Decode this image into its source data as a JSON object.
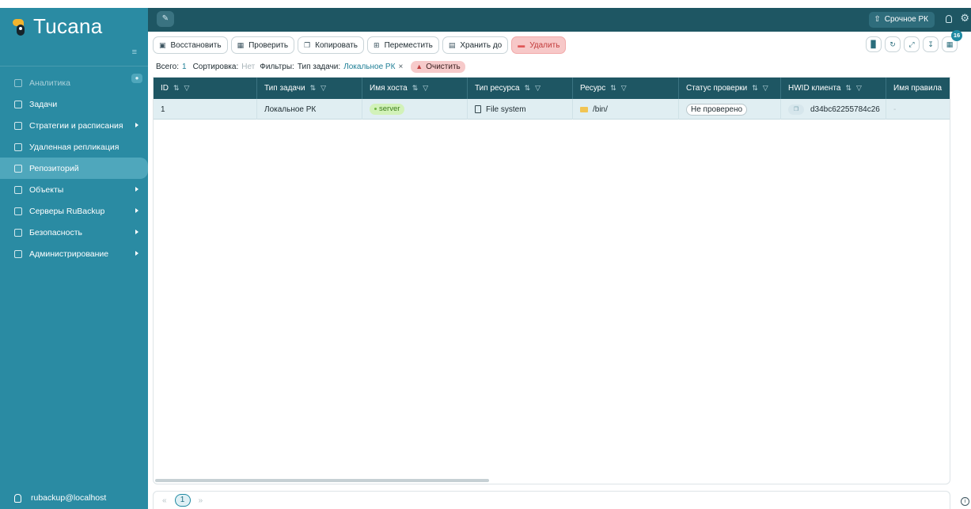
{
  "app": {
    "name": "Tucana"
  },
  "sidebar": {
    "items": [
      {
        "label": "Аналитика",
        "icon": "grid-icon",
        "dim": true
      },
      {
        "label": "Задачи",
        "icon": "tasks-icon"
      },
      {
        "label": "Стратегии и расписания",
        "icon": "calendar-icon",
        "has_arrow": true
      },
      {
        "label": "Удаленная репликация",
        "icon": "replication-icon"
      },
      {
        "label": "Репозиторий",
        "icon": "database-icon",
        "active": true
      },
      {
        "label": "Объекты",
        "icon": "monitor-icon",
        "has_arrow": true
      },
      {
        "label": "Серверы RuBackup",
        "icon": "server-icon",
        "has_arrow": true
      },
      {
        "label": "Безопасность",
        "icon": "lock-icon",
        "has_arrow": true
      },
      {
        "label": "Администрирование",
        "icon": "admin-user-icon",
        "has_arrow": true
      }
    ],
    "user": "rubackup@localhost"
  },
  "topbar": {
    "urgent_label": "Срочное РК"
  },
  "toolbar": {
    "restore": "Восстановить",
    "verify": "Проверить",
    "copy": "Копировать",
    "move": "Переместить",
    "keep_until": "Хранить до",
    "delete": "Удалить",
    "badge_count": "16"
  },
  "filters": {
    "total_label": "Всего:",
    "total_value": "1",
    "sort_label": "Сортировка:",
    "sort_value": "Нет",
    "filters_label": "Фильтры:",
    "filter_name": "Тип задачи:",
    "filter_value": "Локальное РК",
    "remove": "×",
    "clear_label": "Очистить"
  },
  "table": {
    "columns": [
      "ID",
      "Тип задачи",
      "Имя хоста",
      "Тип ресурса",
      "Ресурс",
      "Статус проверки",
      "HWID клиента",
      "Имя правила"
    ],
    "rows": [
      {
        "id": "1",
        "task_type": "Локальное РК",
        "host": "server",
        "resource_type": "File system",
        "resource": "/bin/",
        "check_status": "Не проверено",
        "hwid": "d34bc62255784c26",
        "rule": "-"
      }
    ]
  },
  "pager": {
    "prev": "«",
    "page": "1",
    "next": "»"
  },
  "colors": {
    "sidebar": "#2a8ba3",
    "topbar": "#1e5663",
    "row_selected": "#e0eef2",
    "danger": "#f7c8c8",
    "host_chip": "#d2f2b9"
  }
}
